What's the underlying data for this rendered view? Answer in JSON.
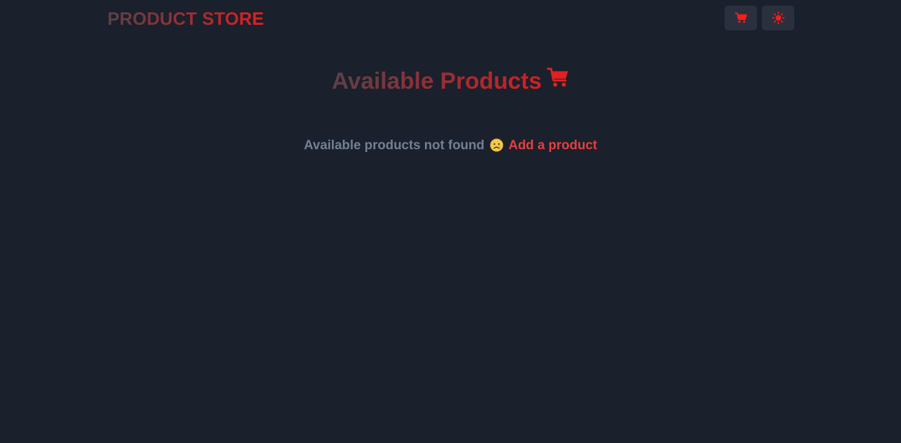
{
  "navbar": {
    "brand": "PRODUCT STORE",
    "cart_icon": "cart-icon",
    "theme_icon": "sun-icon"
  },
  "main": {
    "title": "Available Products",
    "title_icon": "shopping-cart-icon",
    "empty_message": "Available products not found",
    "empty_emoji": "sad-face-emoji",
    "add_link": "Add a product"
  },
  "colors": {
    "background": "#1a202c",
    "button_bg": "#2a303d",
    "accent_red": "#e53e3e",
    "muted_text": "#718096"
  }
}
